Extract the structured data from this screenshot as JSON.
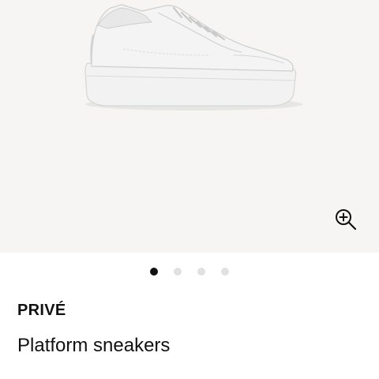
{
  "gallery": {
    "image_alt": "White platform sneaker",
    "zoom_icon": "zoom-in-icon",
    "background_color": "#f6f5f3",
    "dots": [
      {
        "active": true
      },
      {
        "active": false
      },
      {
        "active": false
      },
      {
        "active": false
      }
    ],
    "active_dot_color": "#111111",
    "inactive_dot_color": "#e1e1e3"
  },
  "product": {
    "brand": "PRIVÉ",
    "name": "Platform sneakers"
  }
}
